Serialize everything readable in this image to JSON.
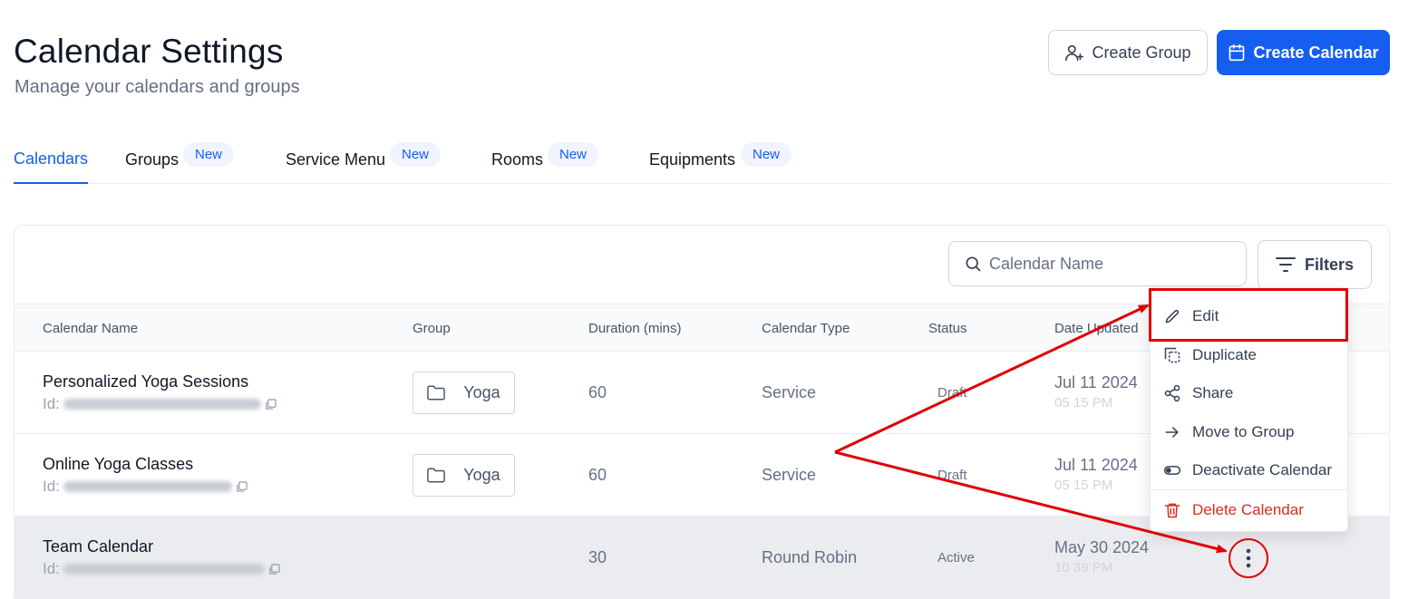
{
  "header": {
    "title": "Calendar Settings",
    "subtitle": "Manage your calendars and groups",
    "create_group_label": "Create Group",
    "create_calendar_label": "Create Calendar"
  },
  "tabs": [
    {
      "label": "Calendars",
      "badge": ""
    },
    {
      "label": "Groups",
      "badge": "New"
    },
    {
      "label": "Service Menu",
      "badge": "New"
    },
    {
      "label": "Rooms",
      "badge": "New"
    },
    {
      "label": "Equipments",
      "badge": "New"
    }
  ],
  "search": {
    "placeholder": "Calendar Name"
  },
  "filters_label": "Filters",
  "columns": [
    "Calendar Name",
    "Group",
    "Duration (mins)",
    "Calendar Type",
    "Status",
    "Date Updated"
  ],
  "rows": [
    {
      "name": "Personalized Yoga Sessions",
      "id_label": "Id:",
      "group": "Yoga",
      "duration": "60",
      "type": "Service",
      "status": "Draft",
      "date": "Jul 11 2024",
      "time": "05 15 PM"
    },
    {
      "name": "Online Yoga Classes",
      "id_label": "Id:",
      "group": "Yoga",
      "duration": "60",
      "type": "Service",
      "status": "Draft",
      "date": "Jul 11 2024",
      "time": "05 15 PM"
    },
    {
      "name": "Team Calendar",
      "id_label": "Id:",
      "group": "",
      "duration": "30",
      "type": "Round Robin",
      "status": "Active",
      "date": "May 30 2024",
      "time": "10 39 PM"
    }
  ],
  "menu": [
    {
      "label": "Edit",
      "icon": "pencil-icon"
    },
    {
      "label": "Duplicate",
      "icon": "duplicate-icon"
    },
    {
      "label": "Share",
      "icon": "share-icon"
    },
    {
      "label": "Move to Group",
      "icon": "arrow-right-icon"
    },
    {
      "label": "Deactivate Calendar",
      "icon": "toggle-icon"
    },
    {
      "label": "Delete Calendar",
      "icon": "trash-icon"
    }
  ],
  "colors": {
    "accent": "#155eef",
    "danger": "#d92d20",
    "annotation": "#e00000"
  }
}
